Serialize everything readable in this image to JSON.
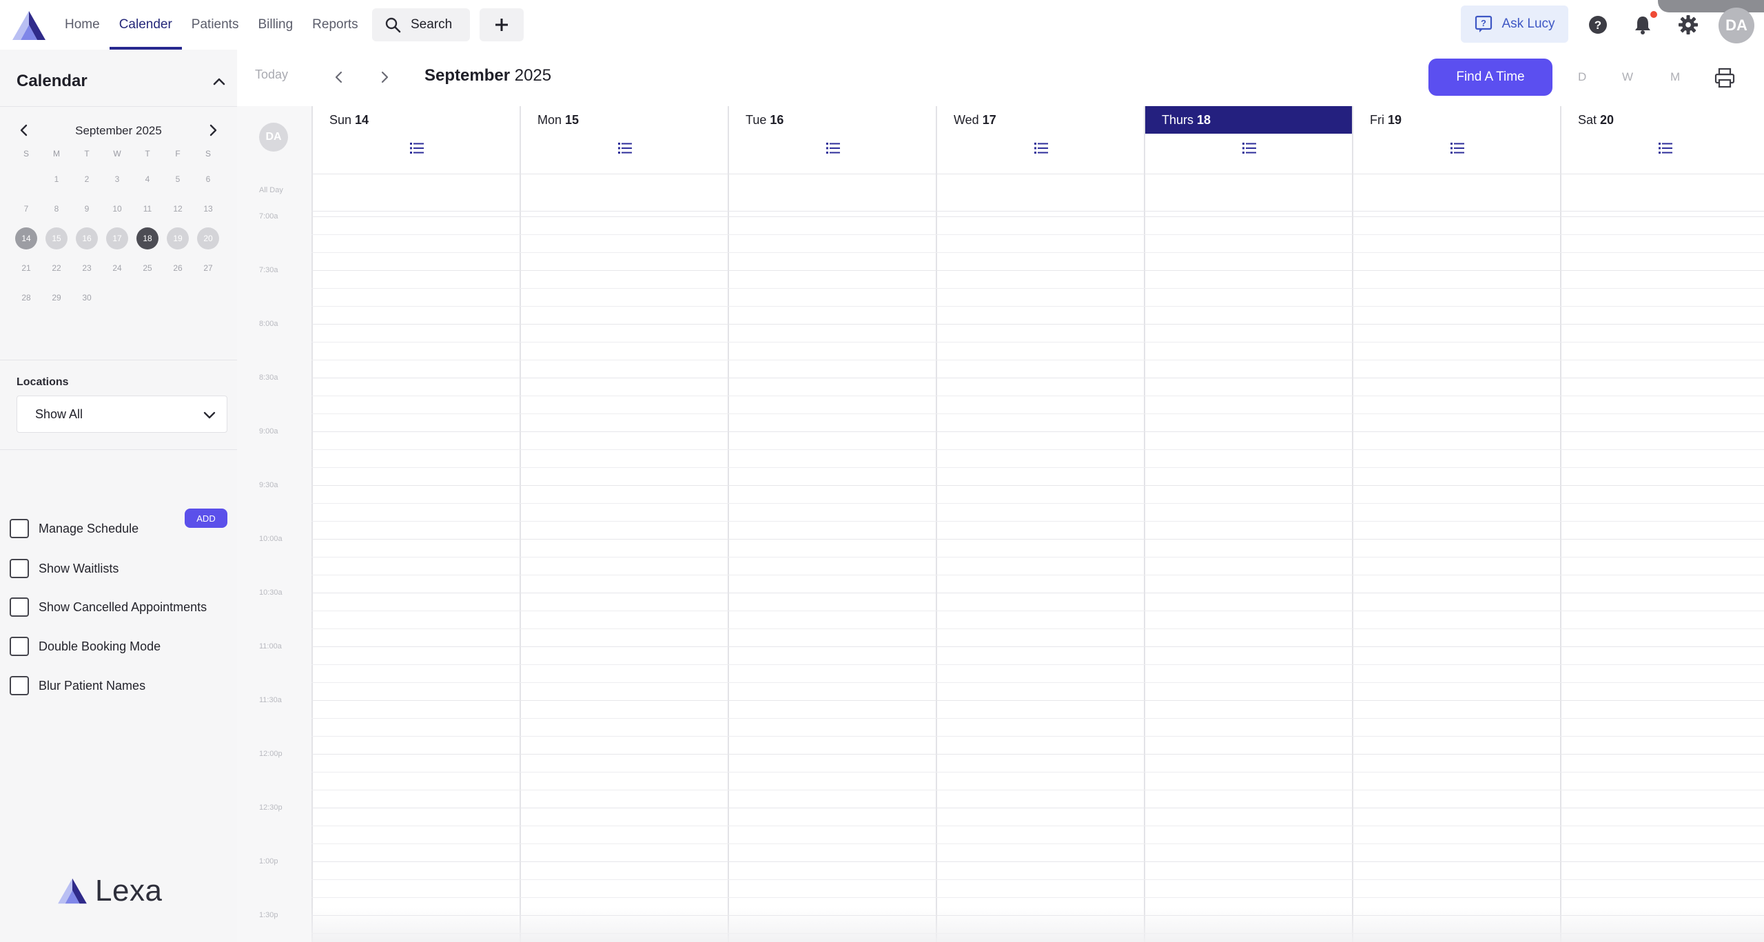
{
  "nav": {
    "items": [
      {
        "label": "Home",
        "active": false
      },
      {
        "label": "Calender",
        "active": true
      },
      {
        "label": "Patients",
        "active": false
      },
      {
        "label": "Billing",
        "active": false
      },
      {
        "label": "Reports",
        "active": false
      }
    ],
    "search_label": "Search",
    "ask_lucy_label": "Ask Lucy",
    "user_initials": "DA"
  },
  "sidebar": {
    "title": "Calendar",
    "mini_calendar": {
      "month_label": "September 2025",
      "dow": [
        "S",
        "M",
        "T",
        "W",
        "T",
        "F",
        "S"
      ],
      "weeks": [
        [
          "",
          "1",
          "2",
          "3",
          "4",
          "5",
          "6"
        ],
        [
          "7",
          "8",
          "9",
          "10",
          "11",
          "12",
          "13"
        ],
        [
          "14",
          "15",
          "16",
          "17",
          "18",
          "19",
          "20"
        ],
        [
          "21",
          "22",
          "23",
          "24",
          "25",
          "26",
          "27"
        ],
        [
          "28",
          "29",
          "30",
          "",
          "",
          "",
          ""
        ]
      ],
      "selected_week_index": 2,
      "today": "18"
    },
    "locations_label": "Locations",
    "location_value": "Show All",
    "options": [
      {
        "label": "Manage Schedule",
        "checked": false
      },
      {
        "label": "Show Waitlists",
        "checked": false
      },
      {
        "label": "Show Cancelled Appointments",
        "checked": false
      },
      {
        "label": "Double Booking Mode",
        "checked": false
      },
      {
        "label": "Blur Patient Names",
        "checked": false
      }
    ],
    "waitlist_add_label": "ADD",
    "brand_name": "Lexa"
  },
  "toolbar": {
    "today_label": "Today",
    "month_bold": "September",
    "year": "2025",
    "find_time_label": "Find A Time",
    "views": [
      "D",
      "W",
      "M"
    ]
  },
  "calendar": {
    "avatar_initials": "DA",
    "all_day_label": "All Day",
    "days": [
      {
        "name": "Sun",
        "date": "14",
        "today": false
      },
      {
        "name": "Mon",
        "date": "15",
        "today": false
      },
      {
        "name": "Tue",
        "date": "16",
        "today": false
      },
      {
        "name": "Wed",
        "date": "17",
        "today": false
      },
      {
        "name": "Thurs",
        "date": "18",
        "today": true
      },
      {
        "name": "Fri",
        "date": "19",
        "today": false
      },
      {
        "name": "Sat",
        "date": "20",
        "today": false
      }
    ],
    "time_labels": [
      "7:00a",
      "7:30a",
      "8:00a",
      "8:30a",
      "9:00a",
      "9:30a",
      "10:00a",
      "10:30a",
      "11:00a",
      "11:30a",
      "12:00p",
      "12:30p",
      "1:00p",
      "1:30p"
    ]
  },
  "colors": {
    "accent": "#5b4ff0",
    "today_header": "#24207f",
    "nav_active": "#27288f"
  }
}
